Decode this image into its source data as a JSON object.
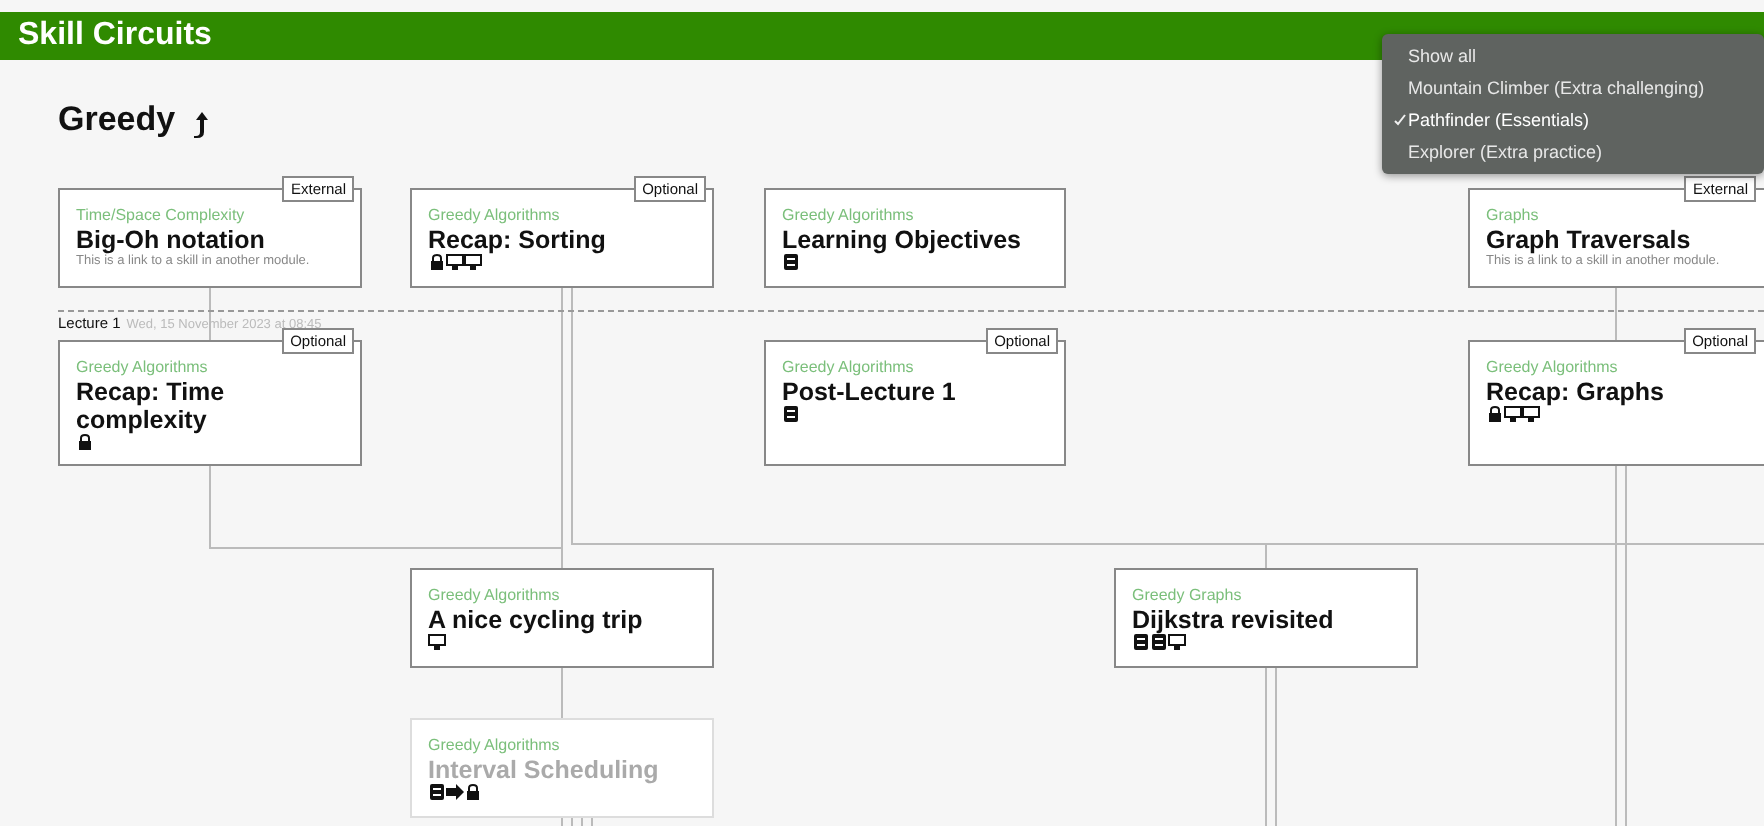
{
  "app_title": "Skill Circuits",
  "circuit_title": "Greedy",
  "lecture": {
    "label": "Lecture 1",
    "date": "Wed, 15 November 2023 at 08:45"
  },
  "skills": [
    {
      "category": "Time/Space Complexity",
      "title": "Big-Oh notation",
      "badge": "External",
      "note": "This is a link to a skill in another module.",
      "dimmed": false
    },
    {
      "category": "Greedy Algorithms",
      "title": "Recap: Sorting",
      "badge": "Optional",
      "dimmed": false,
      "activities": [
        {
          "kind": "lock"
        },
        {
          "kind": "monitor"
        },
        {
          "kind": "monitor"
        }
      ]
    },
    {
      "category": "Greedy Algorithms",
      "title": "Learning Objectives",
      "dimmed": false,
      "activities": [
        {
          "kind": "book"
        }
      ]
    },
    {
      "category": "Graphs",
      "title": "Graph Traversals",
      "badge": "External",
      "note": "This is a link to a skill in another module.",
      "dimmed": false
    },
    {
      "category": "Greedy Algorithms",
      "title": "Recap: Time complexity",
      "badge": "Optional",
      "dimmed": false,
      "activities": [
        {
          "kind": "lock"
        }
      ]
    },
    {
      "category": "Greedy Algorithms",
      "title": "Post-Lecture 1",
      "badge": "Optional",
      "dimmed": false,
      "activities": [
        {
          "kind": "book"
        }
      ]
    },
    {
      "category": "Greedy Algorithms",
      "title": "Recap: Graphs",
      "badge": "Optional",
      "dimmed": false,
      "activities": [
        {
          "kind": "lock"
        },
        {
          "kind": "monitor"
        },
        {
          "kind": "monitor"
        }
      ]
    },
    {
      "category": "Greedy Algorithms",
      "title": "A nice cycling trip",
      "dimmed": false,
      "activities": [
        {
          "kind": "monitor"
        }
      ]
    },
    {
      "category": "Greedy Graphs",
      "title": "Dijkstra revisited",
      "dimmed": false,
      "activities": [
        {
          "kind": "book"
        },
        {
          "kind": "book"
        },
        {
          "kind": "monitor"
        }
      ]
    },
    {
      "category": "Greedy Algorithms",
      "title": "Interval Scheduling",
      "dimmed": true,
      "activities": [
        {
          "kind": "book"
        },
        {
          "kind": "arrow"
        },
        {
          "kind": "lock"
        }
      ]
    }
  ],
  "path_menu": [
    {
      "label": "Show all",
      "selected": false
    },
    {
      "label": "Mountain Climber (Extra challenging)",
      "selected": false
    },
    {
      "label": "Pathfinder (Essentials)",
      "selected": true
    },
    {
      "label": "Explorer (Extra practice)",
      "selected": false
    }
  ]
}
